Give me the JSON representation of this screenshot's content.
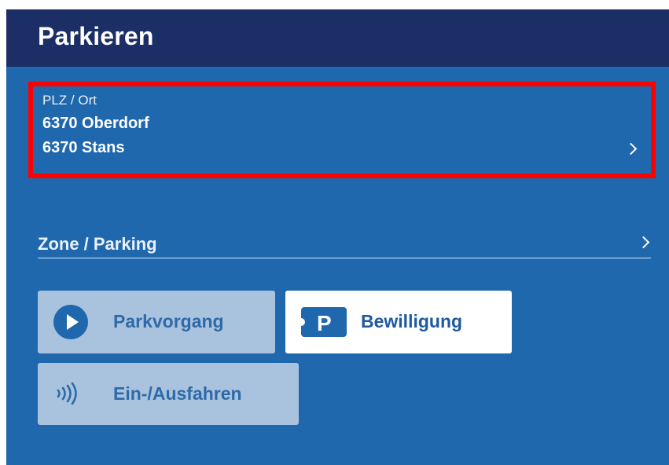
{
  "header": {
    "title": "Parkieren"
  },
  "location": {
    "label": "PLZ / Ort",
    "lines": [
      "6370 Oberdorf",
      "6370 Stans"
    ]
  },
  "zone": {
    "label": "Zone / Parking"
  },
  "actions": {
    "park": {
      "label": "Parkvorgang",
      "icon": "play-circle-icon"
    },
    "bewilligung": {
      "label": "Bewilligung",
      "icon": "parking-ticket-icon"
    },
    "einausfahren": {
      "label": "Ein-/Ausfahren",
      "icon": "nfc-icon"
    }
  },
  "colors": {
    "header": "#1b2e66",
    "panel": "#1f68ad",
    "highlight": "#ff0000",
    "disabled_button": "#a9c2de",
    "active_button": "#ffffff"
  }
}
